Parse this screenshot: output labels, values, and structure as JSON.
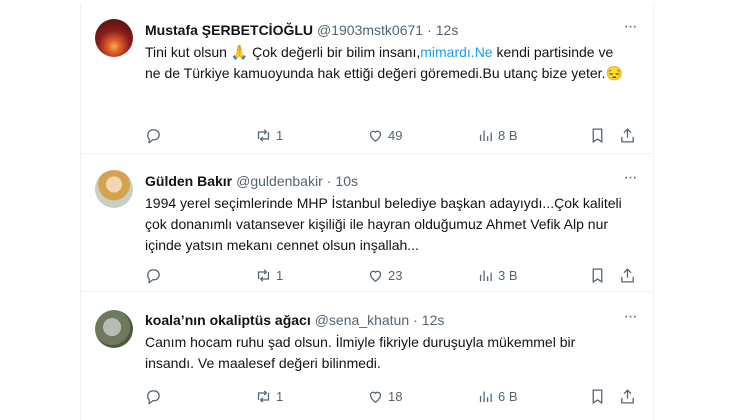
{
  "tweets": [
    {
      "name": "Mustafa ŞERBETCİOĞLU",
      "handle": "@1903mstk0671",
      "time": "12s",
      "text_before": "Tini kut olsun 🙏 Çok değerli bir bilim insanı,",
      "link": "mimardı.Ne",
      "text_after": " kendi partisinde ve ne de Türkiye kamuoyunda hak ettiği değeri göremedi.Bu utanç bize yeter.😔",
      "retweets": "1",
      "likes": "49",
      "views": "8 B",
      "more": "···"
    },
    {
      "name": "Gülden Bakır",
      "handle": "@guldenbakir",
      "time": "10s",
      "text": "1994 yerel seçimlerinde  MHP İstanbul belediye başkan adayıydı...Çok kaliteli çok donanımlı vatansever kişiliği ile hayran olduğumuz Ahmet Vefik Alp nur içinde yatsın mekanı cennet olsun inşallah...",
      "retweets": "1",
      "likes": "23",
      "views": "3 B",
      "more": "···"
    },
    {
      "name": "koala’nın okaliptüs ağacı",
      "handle": "@sena_khatun",
      "time": "12s",
      "text": "Canım hocam ruhu şad olsun. İlmiyle fikriyle duruşuyla mükemmel bir insandı. Ve maalesef değeri bilinmedi.",
      "retweets": "1",
      "likes": "18",
      "views": "6 B",
      "more": "···"
    }
  ],
  "icons": {
    "reply": "reply-icon",
    "retweet": "retweet-icon",
    "like": "heart-icon",
    "views": "views-icon",
    "bookmark": "bookmark-icon",
    "share": "share-icon"
  },
  "colors": {
    "link": "#1d9bf0",
    "muted": "#536471",
    "text": "#0f1419"
  }
}
